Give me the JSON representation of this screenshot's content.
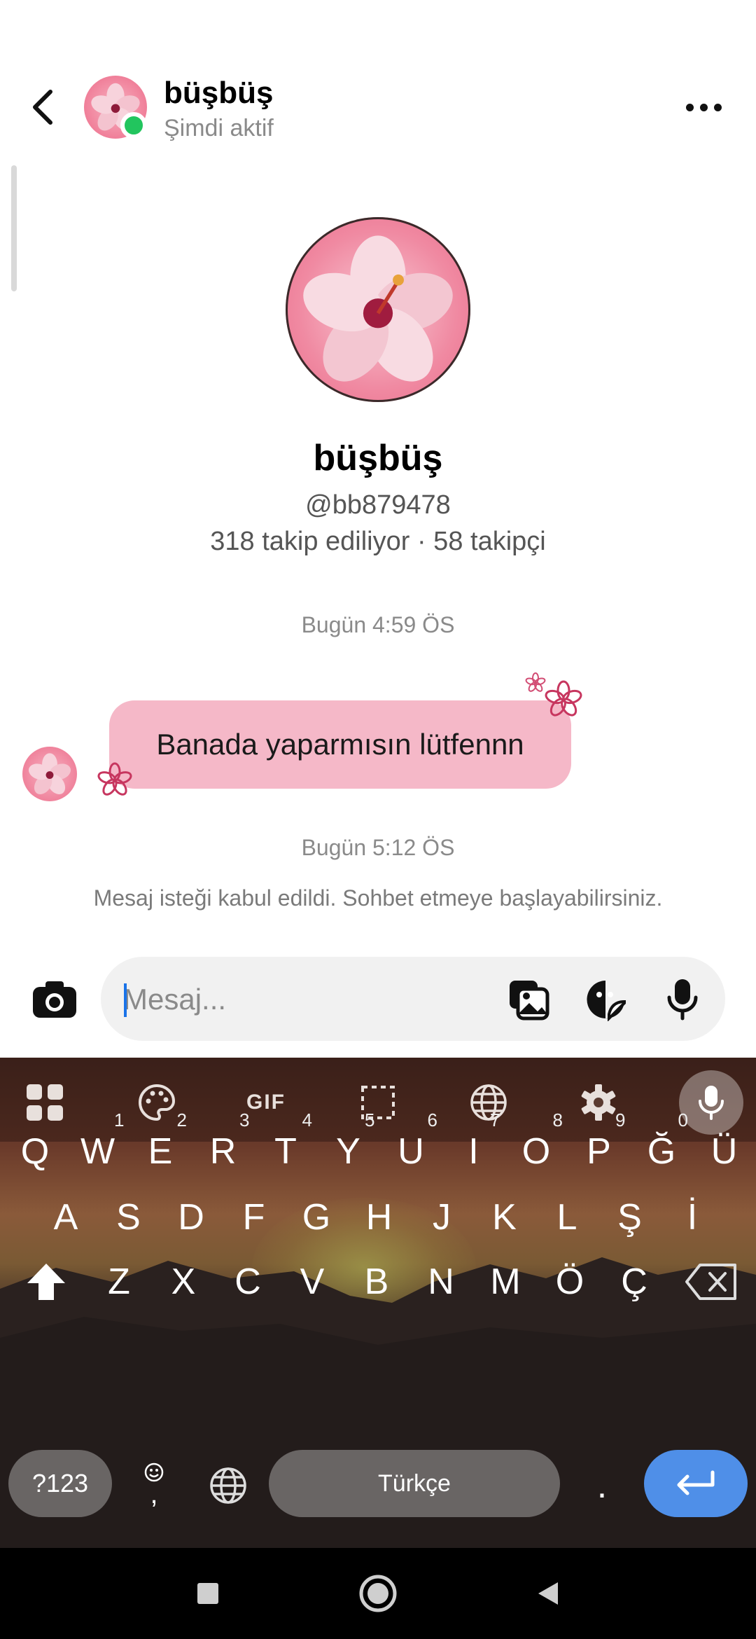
{
  "header": {
    "name": "büşbüş",
    "status": "Şimdi aktif"
  },
  "profile": {
    "name": "büşbüş",
    "handle": "@bb879478",
    "stats": "318 takip ediliyor · 58 takipçi"
  },
  "conversation": {
    "timestamp_1": "Bugün 4:59 ÖS",
    "message_text": "Banada yaparmısın lütfennn",
    "timestamp_2": "Bugün 5:12 ÖS",
    "system_message": "Mesaj isteği kabul edildi. Sohbet etmeye başlayabilirsiniz."
  },
  "composer": {
    "placeholder": "Mesaj..."
  },
  "keyboard": {
    "toolbar": [
      "apps-icon",
      "palette-icon",
      "gif-icon",
      "select-icon",
      "translate-icon",
      "settings-icon",
      "mic-icon"
    ],
    "gif_label": "GIF",
    "row1": [
      "Q",
      "W",
      "E",
      "R",
      "T",
      "Y",
      "U",
      "I",
      "O",
      "P",
      "Ğ",
      "Ü"
    ],
    "row1_hints": [
      "",
      "1",
      "2",
      "3",
      "4",
      "5",
      "6",
      "7",
      "8",
      "9",
      "0",
      ""
    ],
    "row2": [
      "A",
      "S",
      "D",
      "F",
      "G",
      "H",
      "J",
      "K",
      "L",
      "Ş",
      "İ"
    ],
    "row3": [
      "Z",
      "X",
      "C",
      "V",
      "B",
      "N",
      "M",
      "Ö",
      "Ç"
    ],
    "symbols_label": "?123",
    "comma_label": ",",
    "space_label": "Türkçe",
    "period_label": "."
  },
  "colors": {
    "bubble": "#f5b8c8",
    "online": "#22c55e",
    "enter_key": "#4f8fe8"
  }
}
